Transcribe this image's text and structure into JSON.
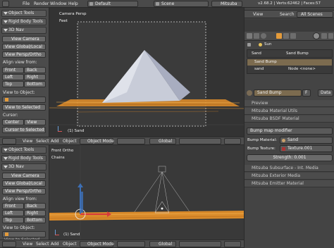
{
  "topbar": {
    "menus": [
      "File",
      "Render",
      "Window",
      "Help"
    ],
    "screen": "Default",
    "scene": "Scene",
    "engine": "Mitsuba",
    "version": "v2.68.2 | Verts:62462 | Faces:57"
  },
  "outliner_header": {
    "view": "View",
    "search": "Search",
    "scope": "All Scenes"
  },
  "shelf_top": {
    "tabs": [
      "Object Tools",
      "Rigid Body Tools",
      "3D Nav"
    ],
    "buttons": [
      "View Camera",
      "View Global/Local",
      "View Persp/Ortho"
    ],
    "align_label": "Align view from:",
    "align": [
      "Front",
      "Back",
      "Left",
      "Right",
      "Top",
      "Bottom"
    ],
    "view_to_object": "View to Object:",
    "view_to_selected": "View to Selected",
    "cursor_label": "Cursor:",
    "cursor": [
      "Center",
      "View"
    ],
    "cursor_to_selected": "Cursor to Selected"
  },
  "viewport_top": {
    "camera_label": "Camera Persp",
    "units": "Feet",
    "object_label": "(1) Sand"
  },
  "header_mid": {
    "view": "View",
    "select": "Select",
    "add": "Add",
    "object": "Object",
    "mode": "Object Mode",
    "orientation": "Global"
  },
  "shelf_bottom": {
    "tabs": [
      "Object Tools",
      "Rigid Body Tools",
      "3D Nav"
    ],
    "buttons": [
      "View Camera",
      "View Global/Local",
      "View Persp/Ortho"
    ],
    "align_label": "Align view from:",
    "align": [
      "Front",
      "Back",
      "Left",
      "Right",
      "Top",
      "Bottom"
    ],
    "view_to_object": "View to Object:",
    "view_to_selected": "View to Selected"
  },
  "viewport_bottom": {
    "view_label": "Front Ortho",
    "units": "Chains",
    "object_label": "(1) Sand"
  },
  "header_bottom": {
    "view": "View",
    "select": "Select",
    "add": "Add",
    "object": "Object",
    "mode": "Object Mode",
    "orientation": "Global"
  },
  "props": {
    "breadcrumb": [
      "Sun"
    ],
    "material_slots": [
      "Sand",
      "Sand Bump"
    ],
    "tree": [
      {
        "label": "Sand Bump",
        "selected": true
      },
      {
        "label": "sand",
        "node": "Node <none>",
        "selected": false
      }
    ],
    "material_name": "Sand Bump",
    "material_f": "F",
    "data_btn": "Data",
    "sections": [
      "Preview",
      "Mitsuba Material Utils",
      "Mitsuba BSDF Material"
    ],
    "bump_type": "Bump map modifier",
    "bump_material_label": "Bump Material:",
    "bump_material": "Sand",
    "bump_texture_label": "Bump Texture:",
    "bump_texture": "Texture.001",
    "strength": "Strength: 0.001",
    "bottom_sections": [
      "Mitsuba Subsurface - Int. Media",
      "Mitsuba Exterior Media",
      "Mitsuba Emitter Material"
    ]
  },
  "colors": {
    "selection": "#e49b3a",
    "accent_blue": "#3d6fb4",
    "ground": "#d98a2a"
  }
}
